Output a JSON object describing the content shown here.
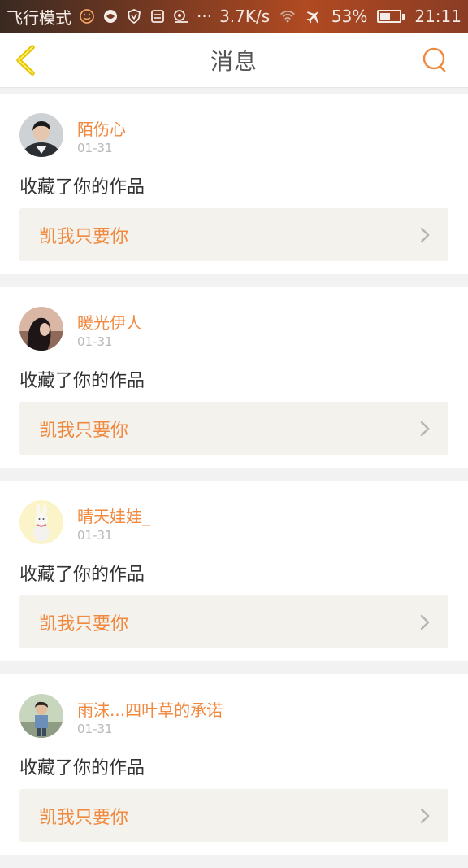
{
  "status_bar": {
    "carrier_mode": "飞行模式",
    "speed": "3.7K/s",
    "battery": "53%",
    "battery_level": 0.53,
    "time": "21:11",
    "icons": [
      "emoji-icon",
      "browser-icon",
      "shield-icon",
      "sim-icon",
      "location-icon",
      "more-icon",
      "wifi-icon",
      "airplane-icon",
      "battery-icon"
    ]
  },
  "header": {
    "title": "消息",
    "back_icon": "chevron-left-icon",
    "search_icon": "search-icon"
  },
  "colors": {
    "accent": "#f0883e",
    "back_icon": "#e5c200",
    "card_link_bg": "#f3f2ec"
  },
  "messages": [
    {
      "user": "陌伤心",
      "date": "01-31",
      "action": "收藏了你的作品",
      "work": "凯我只要你",
      "avatar": "avatar-male-suit"
    },
    {
      "user": "暖光伊人",
      "date": "01-31",
      "action": "收藏了你的作品",
      "work": "凯我只要你",
      "avatar": "avatar-girl-dark"
    },
    {
      "user": "晴天娃娃_",
      "date": "01-31",
      "action": "收藏了你的作品",
      "work": "凯我只要你",
      "avatar": "avatar-bunny"
    },
    {
      "user": "雨沫...四叶草的承诺",
      "date": "01-31",
      "action": "收藏了你的作品",
      "work": "凯我只要你",
      "avatar": "avatar-boy-outdoor"
    }
  ]
}
